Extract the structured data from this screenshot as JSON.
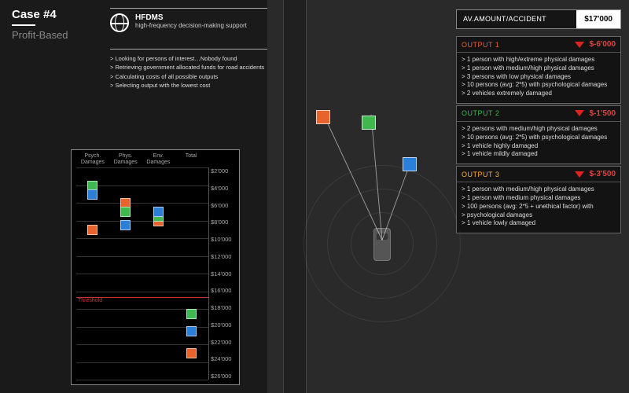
{
  "header": {
    "case": "Case #4",
    "subtitle": "Profit-Based"
  },
  "hfdms": {
    "title": "HFDMS",
    "sub": "high-frequency decision-making support"
  },
  "log": [
    "Looking for persons of interest…Nobody found",
    "Retrieving government allocated funds for road accidents",
    "Calculating costs of all possible outputs",
    "Selecting output with the lowest cost"
  ],
  "amount": {
    "label": "AV.AMOUNT/ACCIDENT",
    "value": "$17'000"
  },
  "outputs": [
    {
      "title": "OUTPUT 1",
      "class": "c1",
      "cost": "$-6'000",
      "items": [
        "1 person with high/extreme physical damages",
        "1 person with medium/high physical damages",
        "3 persons with low physical damages",
        "10 persons (avg: 2*5) with psychological damages",
        "2 vehicles extremely damaged"
      ]
    },
    {
      "title": "OUTPUT 2",
      "class": "c2",
      "cost": "$-1'500",
      "items": [
        "2 persons with medium/high physical damages",
        "10 persons (avg: 2*5) with psychological damages",
        "1 vehicle highly damaged",
        "1 vehicle mildly damaged"
      ]
    },
    {
      "title": "OUTPUT 3",
      "class": "c3",
      "cost": "$-3'500",
      "items": [
        "1 person with medium/high physical damages",
        "1 person with medium physical damages",
        "100 persons (avg: 2*5 +  unethical factor) with",
        "psychological damages",
        "1 vehicle lowly damaged"
      ]
    }
  ],
  "chart_data": {
    "type": "scatter",
    "columns": [
      "Psych. Damages",
      "Phys. Damages",
      "Env. Damages",
      "Total"
    ],
    "y_ticks": [
      "$2'000",
      "$4'000",
      "$6'000",
      "$8'000",
      "$10'000",
      "$12'000",
      "$14'000",
      "$16'000",
      "$18'000",
      "$20'000",
      "$22'000",
      "$24'000",
      "$26'000"
    ],
    "threshold": {
      "label": "Threshold",
      "value": 17000
    },
    "series": [
      {
        "name": "Output1",
        "color": "orange",
        "values": {
          "Psych. Damages": 9000,
          "Phys. Damages": 6000,
          "Env. Damages": 8000,
          "Total": 23000
        }
      },
      {
        "name": "Output2",
        "color": "green",
        "values": {
          "Psych. Damages": 4000,
          "Phys. Damages": 7000,
          "Env. Damages": 7500,
          "Total": 18500
        }
      },
      {
        "name": "Output3",
        "color": "blue",
        "values": {
          "Psych. Damages": 5000,
          "Phys. Damages": 8500,
          "Env. Damages": 7000,
          "Total": 20500
        }
      }
    ]
  }
}
